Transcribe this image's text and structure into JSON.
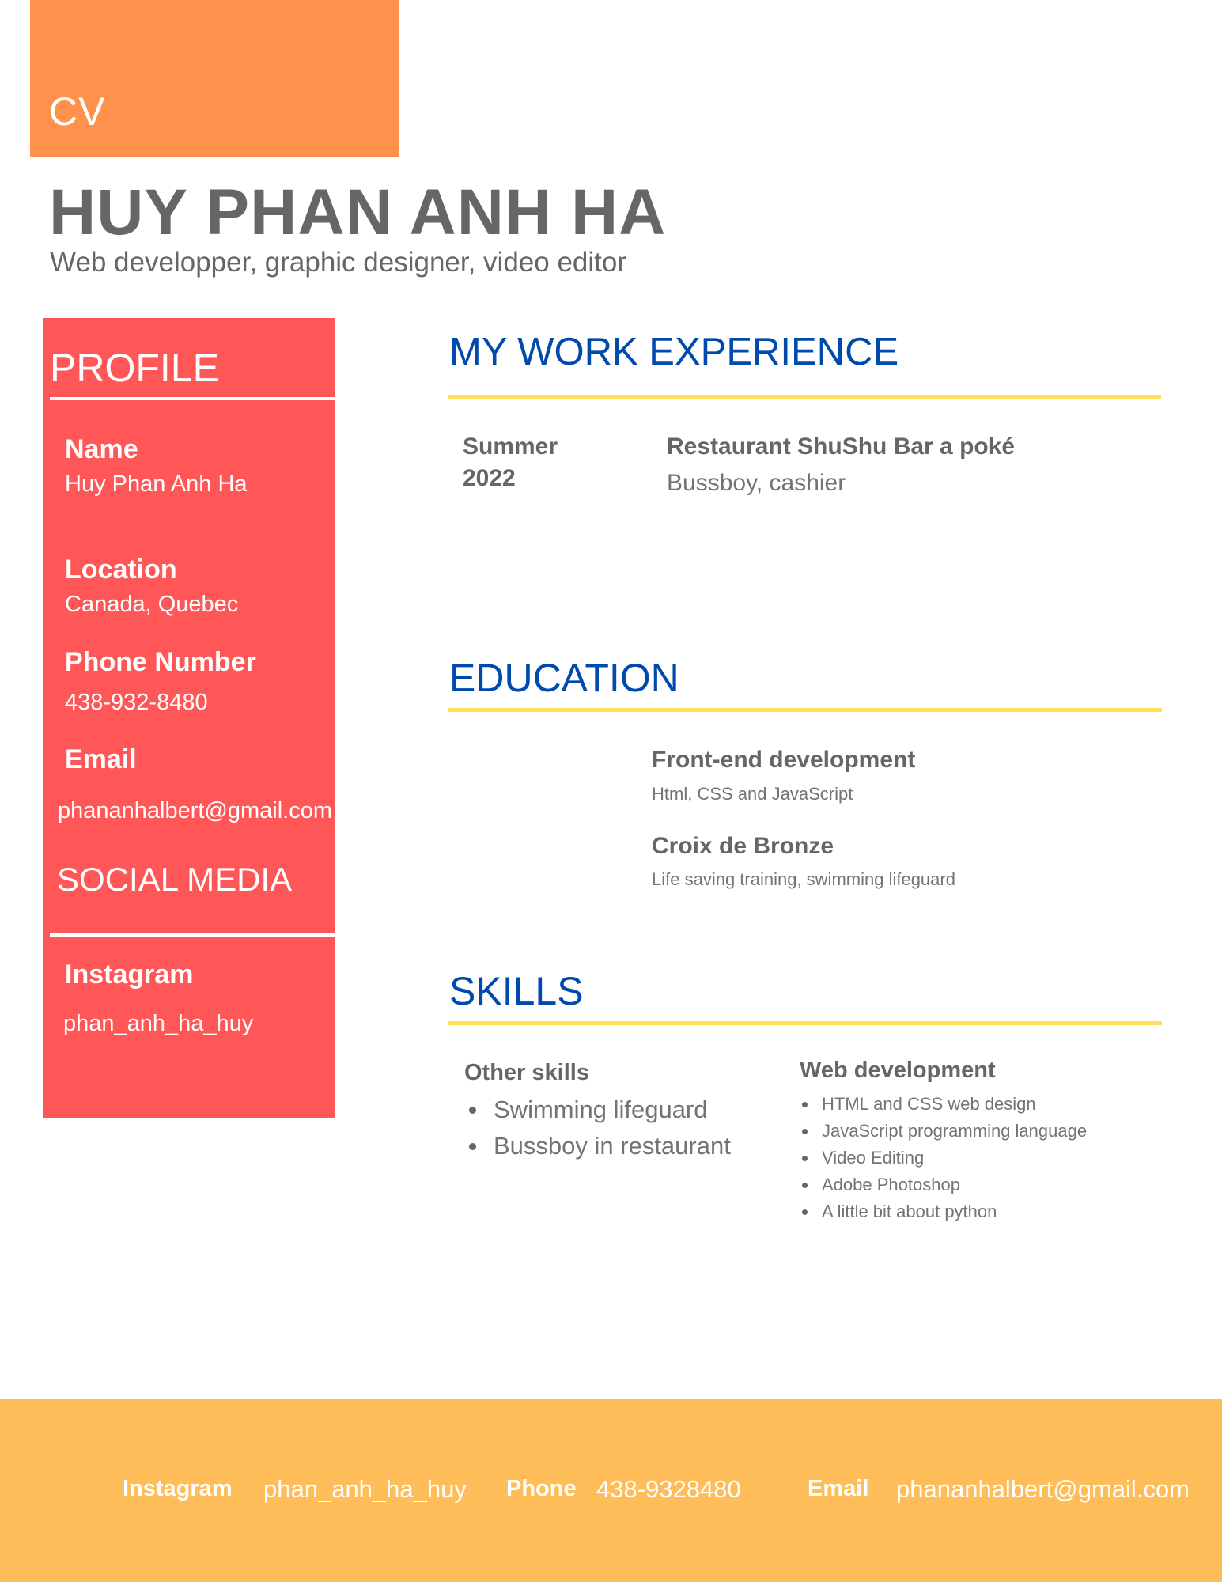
{
  "header": {
    "cv_label": "CV",
    "name": "HUY PHAN ANH HA",
    "subtitle": "Web developper, graphic designer, video editor"
  },
  "profile": {
    "heading": "PROFILE",
    "fields": [
      {
        "label": "Name",
        "value": "Huy Phan Anh Ha"
      },
      {
        "label": "Location",
        "value": "Canada, Quebec"
      },
      {
        "label": "Phone Number",
        "value": "438-932-8480"
      },
      {
        "label": "Email",
        "value": "phananhalbert@gmail.com"
      }
    ],
    "social_heading": "SOCIAL MEDIA",
    "social": [
      {
        "label": "Instagram",
        "value": "phan_anh_ha_huy"
      }
    ]
  },
  "work": {
    "heading": "MY WORK EXPERIENCE",
    "entries": [
      {
        "date_line1": "Summer",
        "date_line2": "2022",
        "employer": "Restaurant ShuShu Bar a poké",
        "role": "Bussboy, cashier"
      }
    ]
  },
  "education": {
    "heading": "EDUCATION",
    "entries": [
      {
        "title": "Front-end development",
        "detail": "Html, CSS and JavaScript"
      },
      {
        "title": "Croix de Bronze",
        "detail": "Life saving training, swimming lifeguard"
      }
    ]
  },
  "skills": {
    "heading": "SKILLS",
    "other": {
      "title": "Other skills",
      "items": [
        "Swimming lifeguard",
        "Bussboy in restaurant"
      ]
    },
    "web": {
      "title": "Web development",
      "items": [
        "HTML and CSS web design",
        "JavaScript programming language",
        "Video Editing",
        "Adobe Photoshop",
        "A little bit about python"
      ]
    }
  },
  "footer": {
    "instagram_label": "Instagram",
    "instagram_value": "phan_anh_ha_huy",
    "phone_label": "Phone",
    "phone_value": "438-9328480",
    "email_label": "Email",
    "email_value": "phananhalbert@gmail.com"
  },
  "colors": {
    "cv_block": "#ff914d",
    "profile_panel": "#ff5757",
    "section_title": "#004aad",
    "section_rule": "#ffde59",
    "footer": "#ffbd59",
    "body_text": "#666666"
  }
}
